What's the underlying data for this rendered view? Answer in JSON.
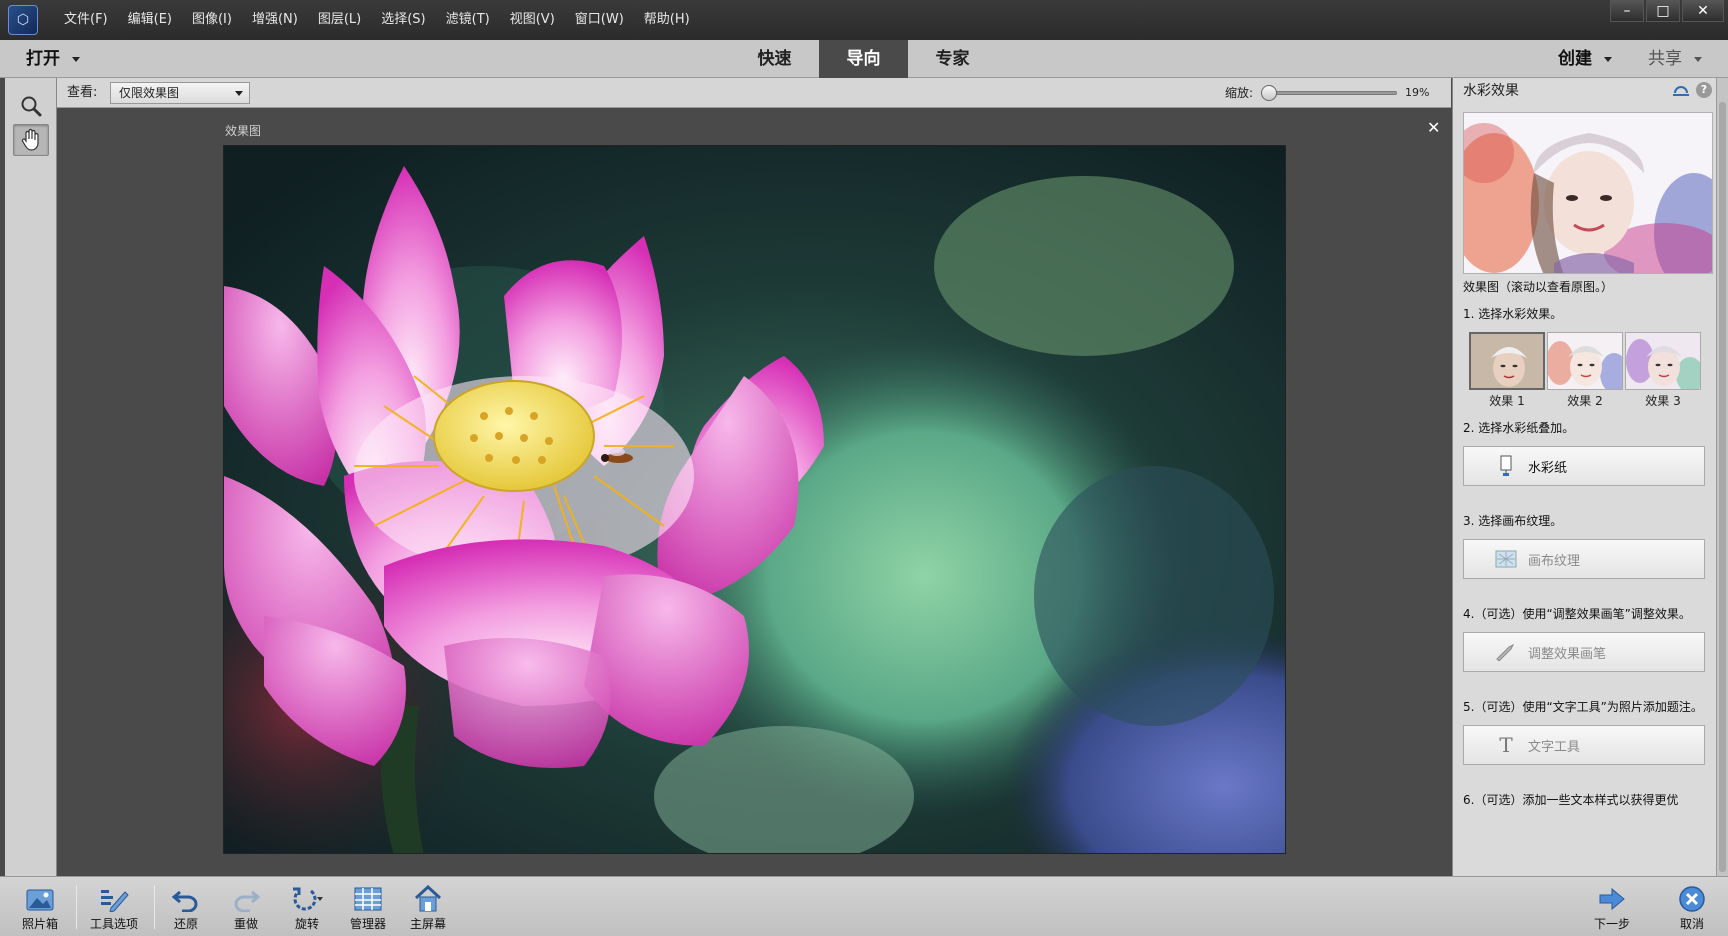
{
  "menu": [
    "文件(F)",
    "编辑(E)",
    "图像(I)",
    "增强(N)",
    "图层(L)",
    "选择(S)",
    "滤镜(T)",
    "视图(V)",
    "窗口(W)",
    "帮助(H)"
  ],
  "window_controls": {
    "minimize": "–",
    "maximize": "□",
    "close": "✕"
  },
  "modebar": {
    "open_label": "打开",
    "tabs": [
      "快速",
      "导向",
      "专家"
    ],
    "active_tab": "导向",
    "create_label": "创建",
    "share_label": "共享"
  },
  "toolbox": [
    "zoom-tool",
    "hand-tool"
  ],
  "options": {
    "view_label": "查看:",
    "view_value": "仅限效果图",
    "zoom_label": "缩放:",
    "zoom_value": "19%",
    "zoom_level": 0.19
  },
  "canvas": {
    "caption": "效果图",
    "close": "✕"
  },
  "panel": {
    "title": "水彩效果",
    "preview_caption": "效果图（滚动以查看原图。）",
    "step1": "1. 选择水彩效果。",
    "effects": [
      "效果 1",
      "效果 2",
      "效果 3"
    ],
    "selected_effect": 0,
    "step2": "2. 选择水彩纸叠加。",
    "btn_paper": "水彩纸",
    "step3": "3. 选择画布纹理。",
    "btn_canvas": "画布纹理",
    "step4": "4.（可选）使用“调整效果画笔”调整效果。",
    "btn_brush": "调整效果画笔",
    "step5": "5.（可选）使用“文字工具”为照片添加题注。",
    "btn_text": "文字工具",
    "step6": "6.（可选）添加一些文本样式以获得更优"
  },
  "bottombar": {
    "photo_bin": "照片箱",
    "tool_options": "工具选项",
    "undo": "还原",
    "redo": "重做",
    "rotate": "旋转",
    "organizer": "管理器",
    "home": "主屏幕",
    "next": "下一步",
    "cancel": "取消"
  },
  "colors": {
    "accent_blue": "#2f6db5",
    "canvas_bg": "#4a4a4a",
    "panel_bg": "#dadada"
  }
}
